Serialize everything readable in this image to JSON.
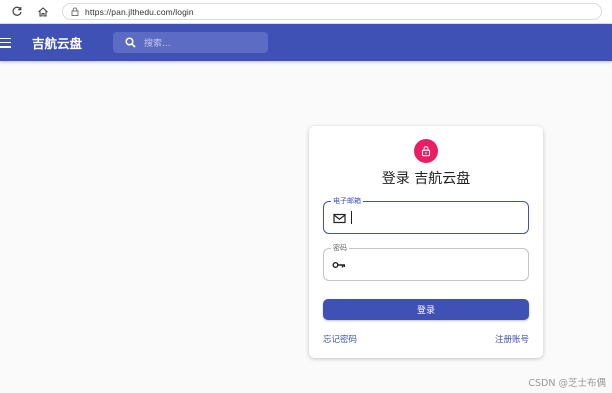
{
  "browser": {
    "url": "https://pan.jlthedu.com/login"
  },
  "appbar": {
    "title": "吉航云盘",
    "search_placeholder": "搜索..."
  },
  "login": {
    "title": "登录 吉航云盘",
    "email_label": "电子邮箱",
    "email_value": "",
    "password_label": "密码",
    "password_value": "",
    "submit_label": "登录",
    "forgot_link": "忘记密码",
    "register_link": "注册账号"
  },
  "watermark": "CSDN @芝士布偶",
  "colors": {
    "primary": "#3f51b5",
    "avatar": "#e91e63"
  }
}
